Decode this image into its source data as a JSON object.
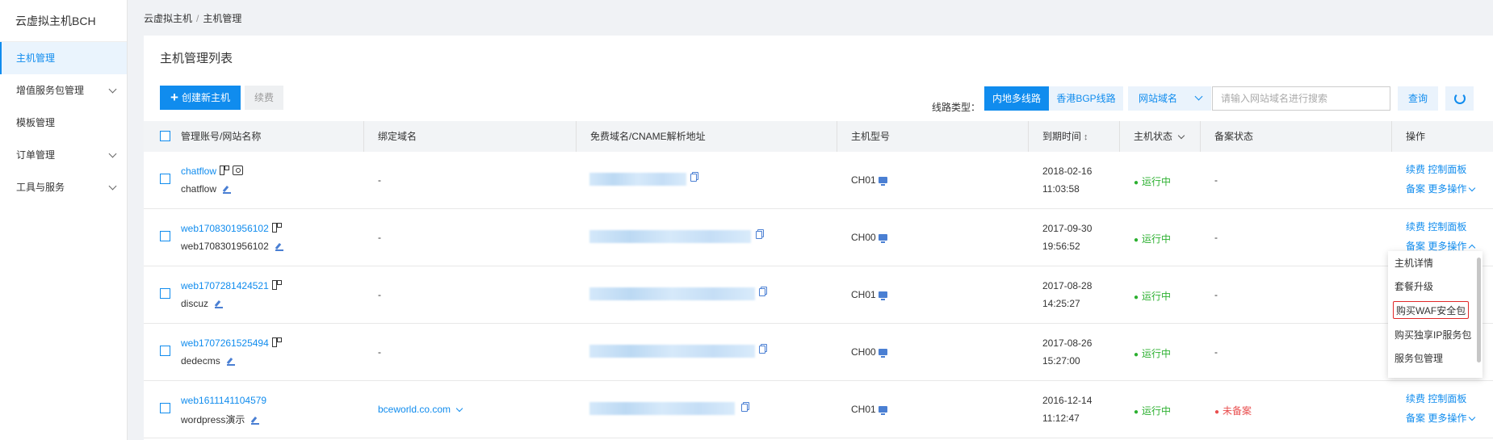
{
  "sidebar": {
    "brand": "云虚拟主机BCH",
    "items": [
      {
        "label": "主机管理"
      },
      {
        "label": "增值服务包管理"
      },
      {
        "label": "模板管理"
      },
      {
        "label": "订单管理"
      },
      {
        "label": "工具与服务"
      }
    ]
  },
  "breadcrumb": {
    "root": "云虚拟主机",
    "sep": "/",
    "current": "主机管理"
  },
  "page": {
    "title": "主机管理列表"
  },
  "toolbar": {
    "create_label": "创建新主机",
    "renew_label": "续费",
    "line_type_label": "线路类型：",
    "line_options": [
      "内地多线路",
      "香港BGP线路"
    ],
    "domain_select": "网站域名",
    "search_placeholder": "请输入网站域名进行搜索",
    "search_label": "查询"
  },
  "table": {
    "headers": {
      "account": "管理账号/网站名称",
      "bind": "绑定域名",
      "cname": "免费域名/CNAME解析地址",
      "model": "主机型号",
      "expire": "到期时间",
      "status": "主机状态",
      "icp": "备案状态",
      "ops": "操作"
    },
    "rows": [
      {
        "account": "chatflow",
        "site": "chatflow",
        "bind": "-",
        "model": "CH01",
        "date": "2018-02-16",
        "time": "11:03:58",
        "status": "运行中",
        "icp": "-"
      },
      {
        "account": "web1708301956102",
        "site": "web1708301956102",
        "bind": "-",
        "model": "CH00",
        "date": "2017-09-30",
        "time": "19:56:52",
        "status": "运行中",
        "icp": "-"
      },
      {
        "account": "web1707281424521",
        "site": "discuz",
        "bind": "-",
        "model": "CH01",
        "date": "2017-08-28",
        "time": "14:25:27",
        "status": "运行中",
        "icp": "-"
      },
      {
        "account": "web1707261525494",
        "site": "dedecms",
        "bind": "-",
        "model": "CH00",
        "date": "2017-08-26",
        "time": "15:27:00",
        "status": "运行中",
        "icp": "-"
      },
      {
        "account": "web1611141104579",
        "site": "wordpress演示",
        "bind": "bceworld.co.com",
        "model": "CH01",
        "date": "2016-12-14",
        "time": "11:12:47",
        "status": "运行中",
        "icp": "未备案"
      }
    ],
    "ops": {
      "renew": "续费",
      "panel": "控制面板",
      "icp": "备案",
      "more": "更多操作"
    }
  },
  "more_menu": {
    "items": [
      "主机详情",
      "套餐升级",
      "购买WAF安全包",
      "购买独享IP服务包",
      "服务包管理"
    ]
  },
  "colors": {
    "primary": "#108cee",
    "running": "#2cb030",
    "unfiled": "#e94f4f",
    "highlight": "#e02828"
  }
}
